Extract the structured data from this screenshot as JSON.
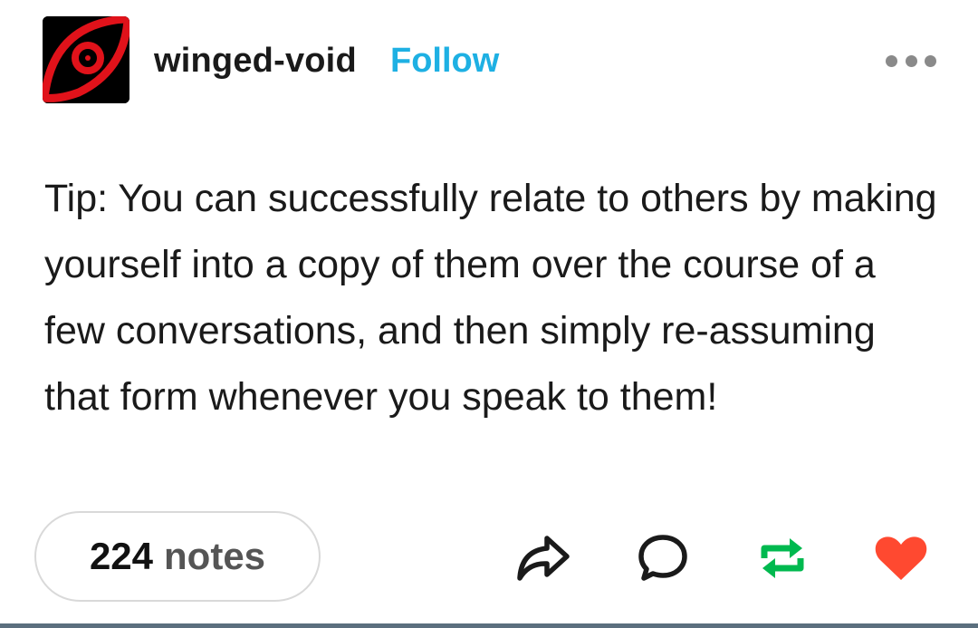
{
  "header": {
    "blog_name": "winged-void",
    "follow_label": "Follow",
    "avatar_icon": "red-eye-icon",
    "more_icon": "more-options-icon"
  },
  "post": {
    "text": "Tip: You can successfully relate to others by making yourself into a copy of them over the course of a few conversations, and then simply re-assuming that form whenever you speak to them!"
  },
  "footer": {
    "notes_count": "224",
    "notes_label": "notes",
    "actions": [
      {
        "name": "share",
        "icon": "share-arrow-icon"
      },
      {
        "name": "reply",
        "icon": "speech-bubble-icon"
      },
      {
        "name": "reblog",
        "icon": "reblog-icon"
      },
      {
        "name": "like",
        "icon": "heart-icon"
      }
    ]
  },
  "colors": {
    "follow": "#1eb0e3",
    "reblog": "#00b94f",
    "like": "#ff4930",
    "avatar_red": "#e0121a",
    "icon_gray": "#1a1a1a"
  }
}
